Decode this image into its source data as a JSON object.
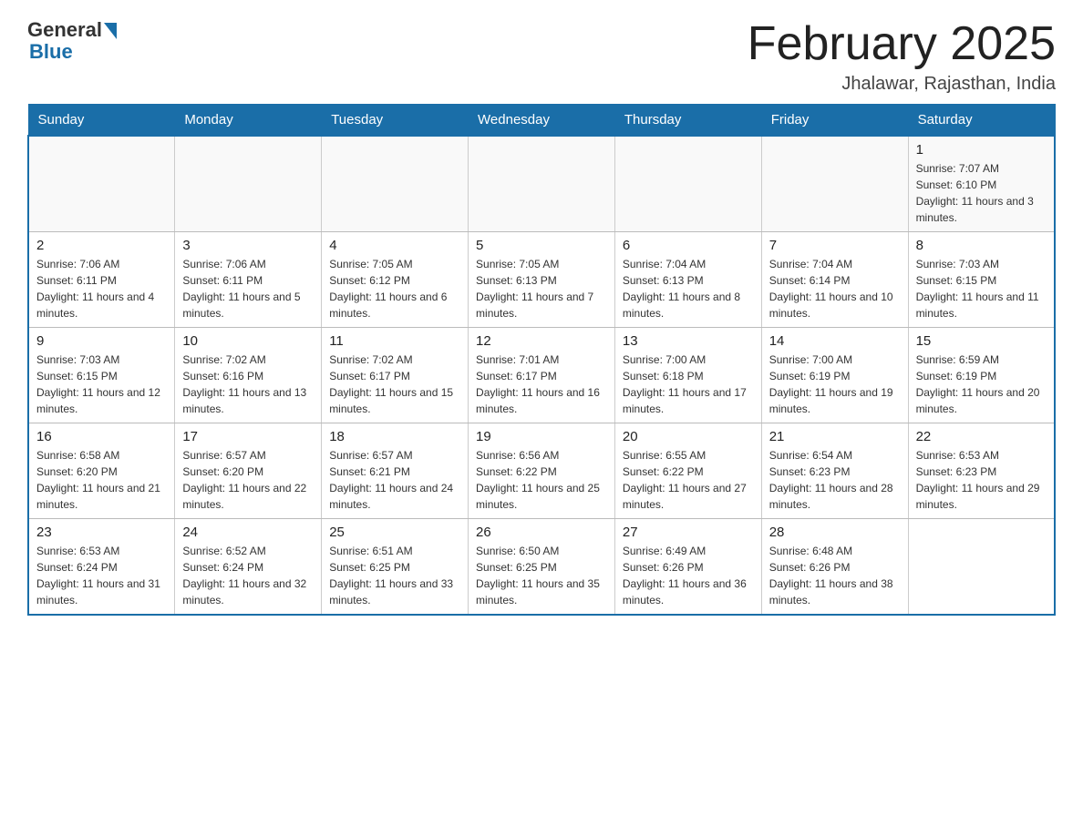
{
  "header": {
    "logo_general": "General",
    "logo_blue": "Blue",
    "title": "February 2025",
    "subtitle": "Jhalawar, Rajasthan, India"
  },
  "calendar": {
    "days_of_week": [
      "Sunday",
      "Monday",
      "Tuesday",
      "Wednesday",
      "Thursday",
      "Friday",
      "Saturday"
    ],
    "weeks": [
      [
        {
          "day": "",
          "info": ""
        },
        {
          "day": "",
          "info": ""
        },
        {
          "day": "",
          "info": ""
        },
        {
          "day": "",
          "info": ""
        },
        {
          "day": "",
          "info": ""
        },
        {
          "day": "",
          "info": ""
        },
        {
          "day": "1",
          "info": "Sunrise: 7:07 AM\nSunset: 6:10 PM\nDaylight: 11 hours and 3 minutes."
        }
      ],
      [
        {
          "day": "2",
          "info": "Sunrise: 7:06 AM\nSunset: 6:11 PM\nDaylight: 11 hours and 4 minutes."
        },
        {
          "day": "3",
          "info": "Sunrise: 7:06 AM\nSunset: 6:11 PM\nDaylight: 11 hours and 5 minutes."
        },
        {
          "day": "4",
          "info": "Sunrise: 7:05 AM\nSunset: 6:12 PM\nDaylight: 11 hours and 6 minutes."
        },
        {
          "day": "5",
          "info": "Sunrise: 7:05 AM\nSunset: 6:13 PM\nDaylight: 11 hours and 7 minutes."
        },
        {
          "day": "6",
          "info": "Sunrise: 7:04 AM\nSunset: 6:13 PM\nDaylight: 11 hours and 8 minutes."
        },
        {
          "day": "7",
          "info": "Sunrise: 7:04 AM\nSunset: 6:14 PM\nDaylight: 11 hours and 10 minutes."
        },
        {
          "day": "8",
          "info": "Sunrise: 7:03 AM\nSunset: 6:15 PM\nDaylight: 11 hours and 11 minutes."
        }
      ],
      [
        {
          "day": "9",
          "info": "Sunrise: 7:03 AM\nSunset: 6:15 PM\nDaylight: 11 hours and 12 minutes."
        },
        {
          "day": "10",
          "info": "Sunrise: 7:02 AM\nSunset: 6:16 PM\nDaylight: 11 hours and 13 minutes."
        },
        {
          "day": "11",
          "info": "Sunrise: 7:02 AM\nSunset: 6:17 PM\nDaylight: 11 hours and 15 minutes."
        },
        {
          "day": "12",
          "info": "Sunrise: 7:01 AM\nSunset: 6:17 PM\nDaylight: 11 hours and 16 minutes."
        },
        {
          "day": "13",
          "info": "Sunrise: 7:00 AM\nSunset: 6:18 PM\nDaylight: 11 hours and 17 minutes."
        },
        {
          "day": "14",
          "info": "Sunrise: 7:00 AM\nSunset: 6:19 PM\nDaylight: 11 hours and 19 minutes."
        },
        {
          "day": "15",
          "info": "Sunrise: 6:59 AM\nSunset: 6:19 PM\nDaylight: 11 hours and 20 minutes."
        }
      ],
      [
        {
          "day": "16",
          "info": "Sunrise: 6:58 AM\nSunset: 6:20 PM\nDaylight: 11 hours and 21 minutes."
        },
        {
          "day": "17",
          "info": "Sunrise: 6:57 AM\nSunset: 6:20 PM\nDaylight: 11 hours and 22 minutes."
        },
        {
          "day": "18",
          "info": "Sunrise: 6:57 AM\nSunset: 6:21 PM\nDaylight: 11 hours and 24 minutes."
        },
        {
          "day": "19",
          "info": "Sunrise: 6:56 AM\nSunset: 6:22 PM\nDaylight: 11 hours and 25 minutes."
        },
        {
          "day": "20",
          "info": "Sunrise: 6:55 AM\nSunset: 6:22 PM\nDaylight: 11 hours and 27 minutes."
        },
        {
          "day": "21",
          "info": "Sunrise: 6:54 AM\nSunset: 6:23 PM\nDaylight: 11 hours and 28 minutes."
        },
        {
          "day": "22",
          "info": "Sunrise: 6:53 AM\nSunset: 6:23 PM\nDaylight: 11 hours and 29 minutes."
        }
      ],
      [
        {
          "day": "23",
          "info": "Sunrise: 6:53 AM\nSunset: 6:24 PM\nDaylight: 11 hours and 31 minutes."
        },
        {
          "day": "24",
          "info": "Sunrise: 6:52 AM\nSunset: 6:24 PM\nDaylight: 11 hours and 32 minutes."
        },
        {
          "day": "25",
          "info": "Sunrise: 6:51 AM\nSunset: 6:25 PM\nDaylight: 11 hours and 33 minutes."
        },
        {
          "day": "26",
          "info": "Sunrise: 6:50 AM\nSunset: 6:25 PM\nDaylight: 11 hours and 35 minutes."
        },
        {
          "day": "27",
          "info": "Sunrise: 6:49 AM\nSunset: 6:26 PM\nDaylight: 11 hours and 36 minutes."
        },
        {
          "day": "28",
          "info": "Sunrise: 6:48 AM\nSunset: 6:26 PM\nDaylight: 11 hours and 38 minutes."
        },
        {
          "day": "",
          "info": ""
        }
      ]
    ]
  }
}
